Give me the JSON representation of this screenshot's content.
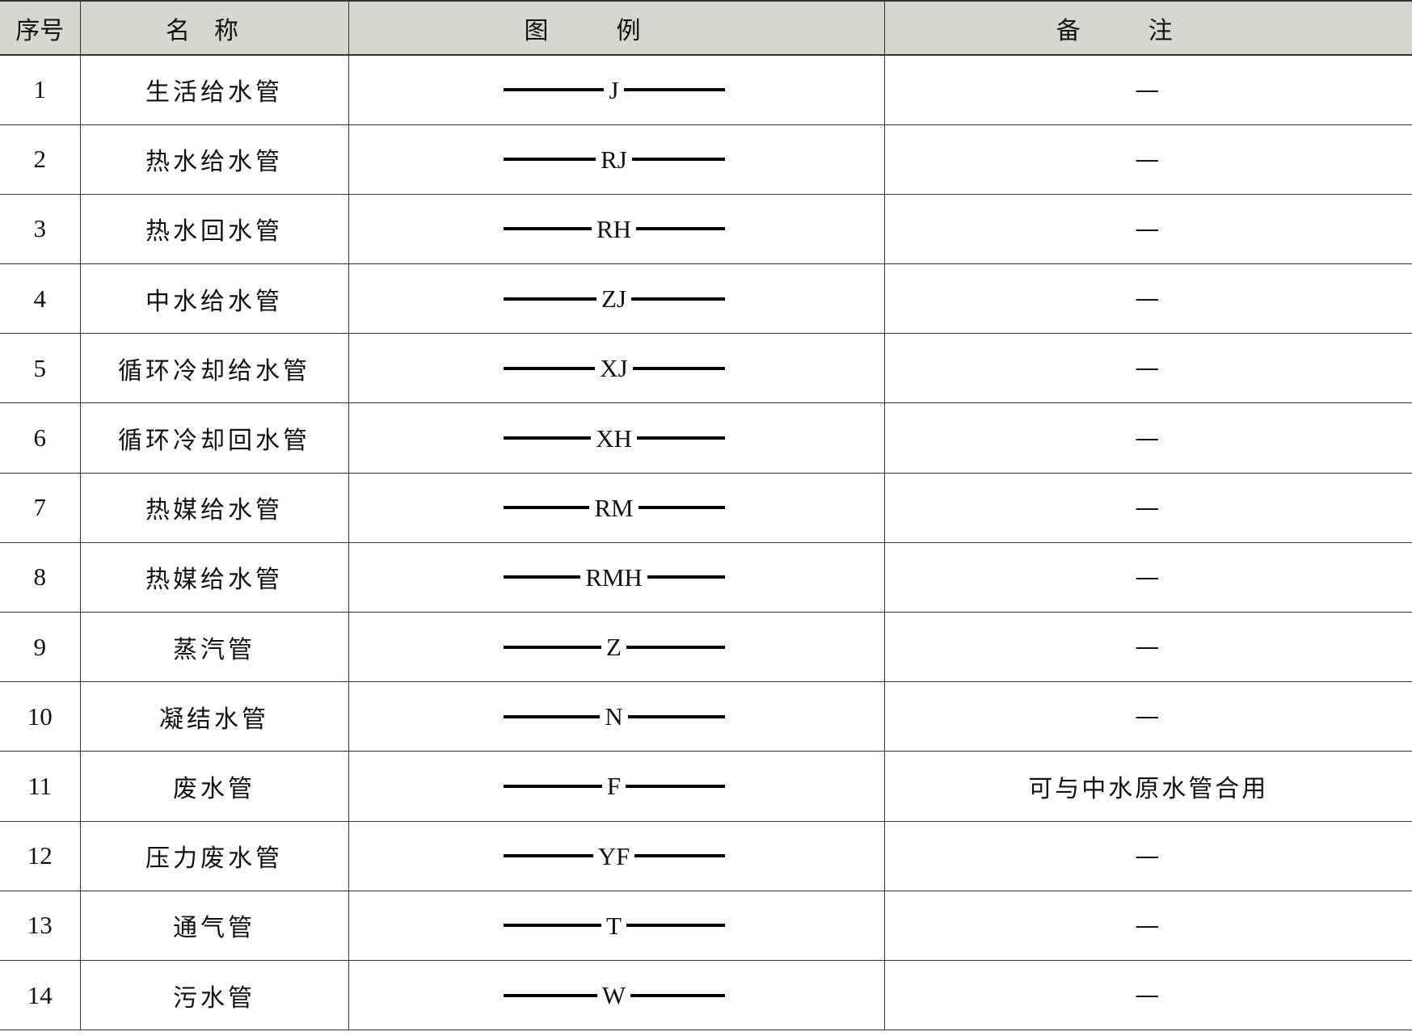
{
  "table": {
    "headers": {
      "no": "序号",
      "name": "名称",
      "legend": "图例",
      "note": "备注"
    },
    "rows": [
      {
        "no": "1",
        "name": "生活给水管",
        "code": "J",
        "note": "—"
      },
      {
        "no": "2",
        "name": "热水给水管",
        "code": "RJ",
        "note": "—"
      },
      {
        "no": "3",
        "name": "热水回水管",
        "code": "RH",
        "note": "—"
      },
      {
        "no": "4",
        "name": "中水给水管",
        "code": "ZJ",
        "note": "—"
      },
      {
        "no": "5",
        "name": "循环冷却给水管",
        "code": "XJ",
        "note": "—"
      },
      {
        "no": "6",
        "name": "循环冷却回水管",
        "code": "XH",
        "note": "—"
      },
      {
        "no": "7",
        "name": "热媒给水管",
        "code": "RM",
        "note": "—"
      },
      {
        "no": "8",
        "name": "热媒给水管",
        "code": "RMH",
        "note": "—"
      },
      {
        "no": "9",
        "name": "蒸汽管",
        "code": "Z",
        "note": "—"
      },
      {
        "no": "10",
        "name": "凝结水管",
        "code": "N",
        "note": "—"
      },
      {
        "no": "11",
        "name": "废水管",
        "code": "F",
        "note": "可与中水原水管合用"
      },
      {
        "no": "12",
        "name": "压力废水管",
        "code": "YF",
        "note": "—"
      },
      {
        "no": "13",
        "name": "通气管",
        "code": "T",
        "note": "—"
      },
      {
        "no": "14",
        "name": "污水管",
        "code": "W",
        "note": "—"
      }
    ]
  },
  "colors": {
    "header_bg": "#d6d8d0",
    "border": "#333333",
    "line": "#000000"
  }
}
